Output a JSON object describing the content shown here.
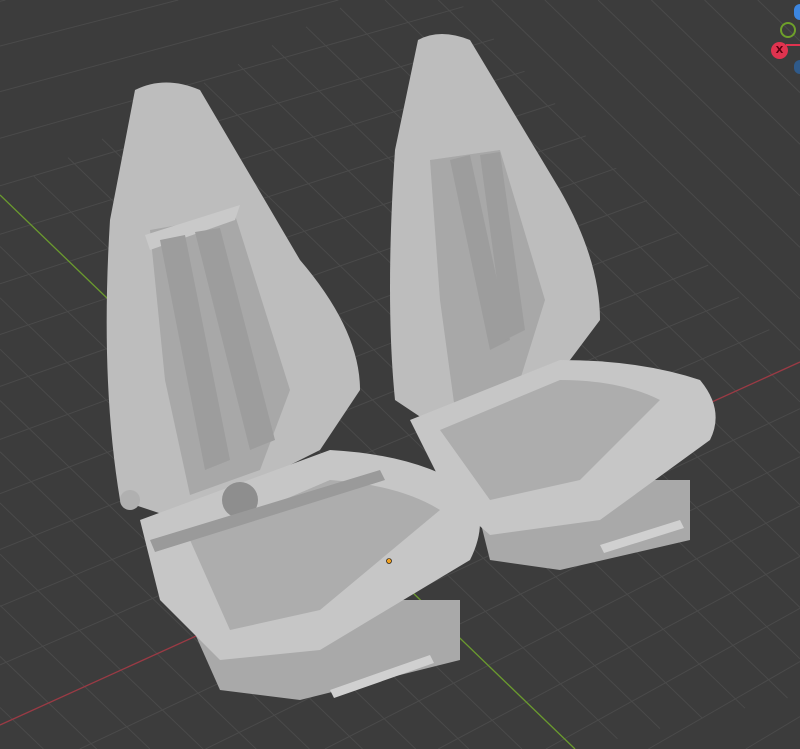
{
  "viewport": {
    "background": "#3c3c3c",
    "grid_color": "#4a4a4a",
    "x_axis_color": "#9a3a44",
    "y_axis_color": "#6a9a2e",
    "objects": [
      "seat-left",
      "seat-right"
    ],
    "origin_color": "#f0a020"
  },
  "gizmo": {
    "x_label": "X",
    "x_color": "#e0334f",
    "y_color": "#6ea02a",
    "z_color": "#3c86e0"
  }
}
